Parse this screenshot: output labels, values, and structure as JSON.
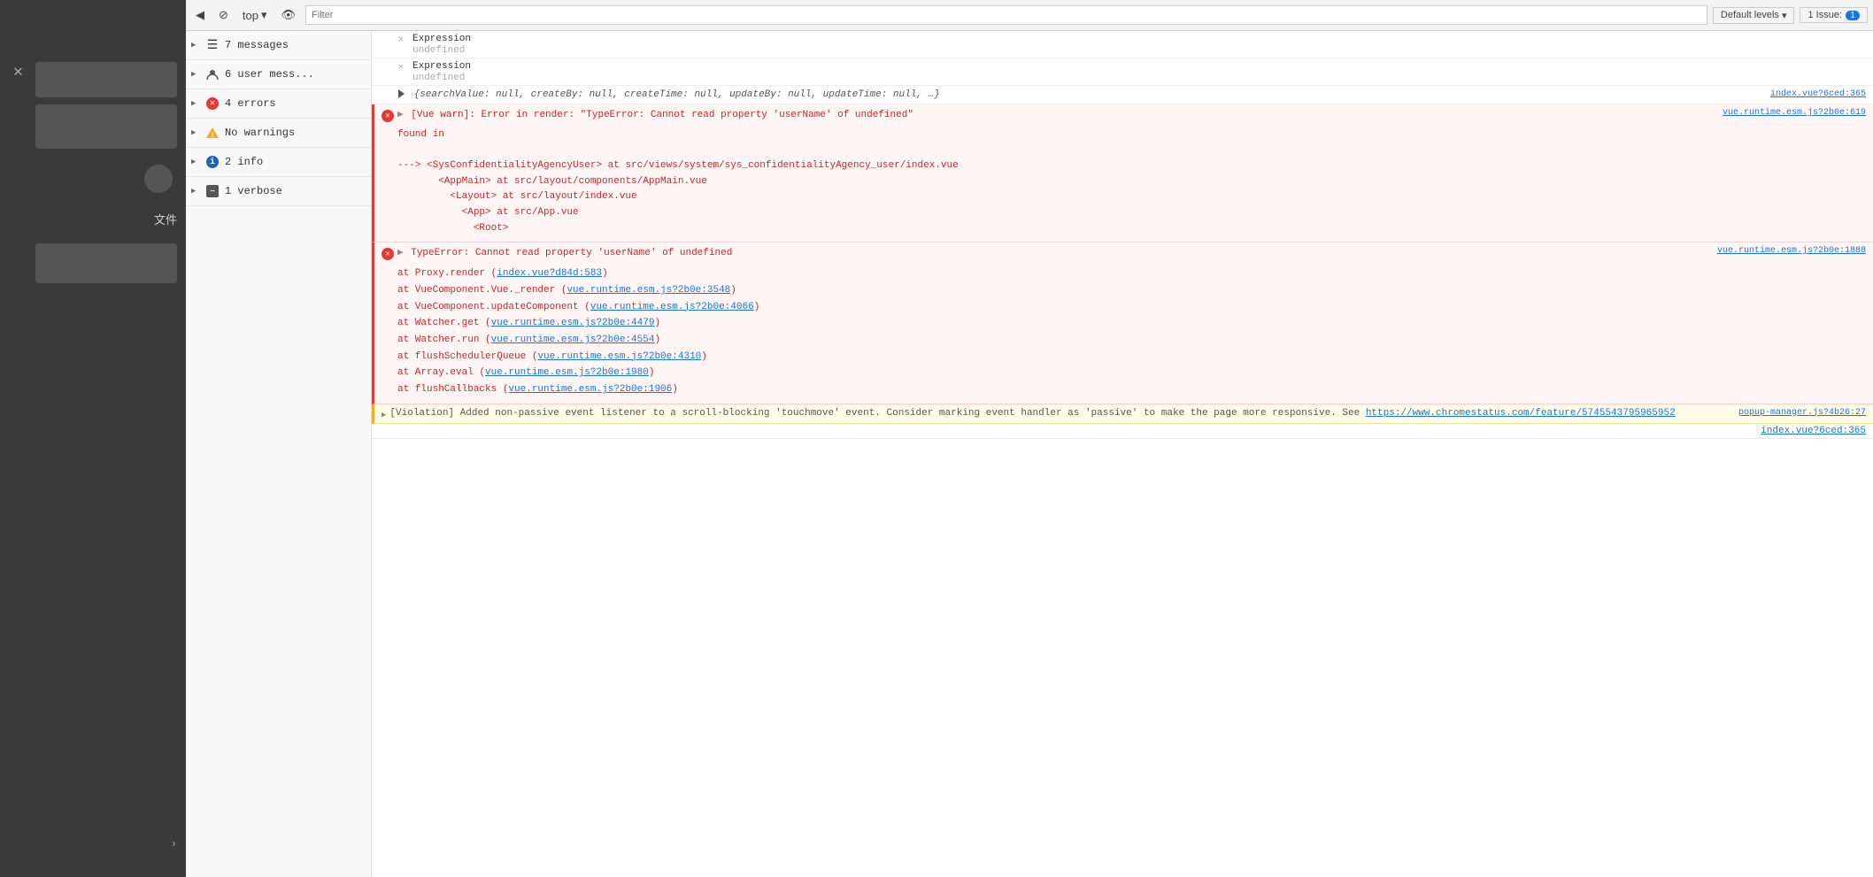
{
  "toolbar": {
    "back_icon": "◀",
    "block_icon": "⊘",
    "context_label": "top",
    "context_arrow": "▾",
    "eye_icon": "👁",
    "filter_placeholder": "Filter",
    "levels_label": "Default levels",
    "levels_arrow": "▾",
    "issue_label": "1 Issue:",
    "issue_count": "1"
  },
  "message_list": {
    "items": [
      {
        "id": "all-messages",
        "icon": "list",
        "label": "7 messages",
        "expanded": true
      },
      {
        "id": "user-messages",
        "icon": "user",
        "label": "6 user mess...",
        "expanded": false
      },
      {
        "id": "errors",
        "icon": "error",
        "label": "4 errors",
        "expanded": false
      },
      {
        "id": "warnings",
        "icon": "warning",
        "label": "No warnings",
        "expanded": false
      },
      {
        "id": "info",
        "icon": "info",
        "label": "2 info",
        "expanded": false
      },
      {
        "id": "verbose",
        "icon": "verbose",
        "label": "1 verbose",
        "expanded": false
      }
    ]
  },
  "console": {
    "entries": [
      {
        "type": "expression",
        "label": "Expression",
        "value": "undefined",
        "source": ""
      },
      {
        "type": "expression",
        "label": "Expression",
        "value": "undefined",
        "source": ""
      },
      {
        "type": "object",
        "text": "{searchValue: null, createBy: null, createTime: null, updateBy: null, updateTime: null, …}",
        "source": "index.vue?6ced:365"
      },
      {
        "type": "error",
        "message": "[Vue warn]: Error in render: \"TypeError: Cannot read property 'userName' of undefined\"",
        "detail": "found in\n\n---> <SysConfidentialityAgencyUser> at src/views/system/sys_confidentialityAgency_user/index.vue\n       <AppMain> at src/layout/components/AppMain.vue\n         <Layout> at src/layout/index.vue\n           <App> at src/App.vue\n             <Root>",
        "source": "vue.runtime.esm.js?2b0e:619"
      },
      {
        "type": "error",
        "message": "TypeError: Cannot read property 'userName' of undefined",
        "detail": "    at Proxy.render (index.vue?d84d:583)\n    at VueComponent.Vue._render (vue.runtime.esm.js?2b0e:3548)\n    at VueComponent.updateComponent (vue.runtime.esm.js?2b0e:4066)\n    at Watcher.get (vue.runtime.esm.js?2b0e:4479)\n    at Watcher.run (vue.runtime.esm.js?2b0e:4554)\n    at flushSchedulerQueue (vue.runtime.esm.js?2b0e:4310)\n    at Array.eval (vue.runtime.esm.js?2b0e:1980)\n    at flushCallbacks (vue.runtime.esm.js?2b0e:1906)",
        "source": "vue.runtime.esm.js?2b0e:1888",
        "inlineSources": [
          {
            "text": "index.vue?d84d:583",
            "url": "#"
          },
          {
            "text": "vue.runtime.esm.js?2b0e:3548",
            "url": "#"
          },
          {
            "text": "vue.runtime.esm.js?2b0e:4066",
            "url": "#"
          },
          {
            "text": "vue.runtime.esm.js?2b0e:4479",
            "url": "#"
          },
          {
            "text": "vue.runtime.esm.js?2b0e:4554",
            "url": "#"
          },
          {
            "text": "vue.runtime.esm.js?2b0e:4310",
            "url": "#"
          },
          {
            "text": "vue.runtime.esm.js?2b0e:1980",
            "url": "#"
          },
          {
            "text": "vue.runtime.esm.js?2b0e:1906",
            "url": "#"
          }
        ]
      },
      {
        "type": "violation",
        "message": "[Violation] Added non-passive event listener to a scroll-blocking 'touchmove'  event. Consider marking event handler as 'passive' to make the page more responsive. See ",
        "link": "https://www.chromestatus.com/feature/5745543795965952",
        "source": "popup-manager.js?4b26:27",
        "bottomSource": "index.vue?6ced:365"
      }
    ]
  }
}
